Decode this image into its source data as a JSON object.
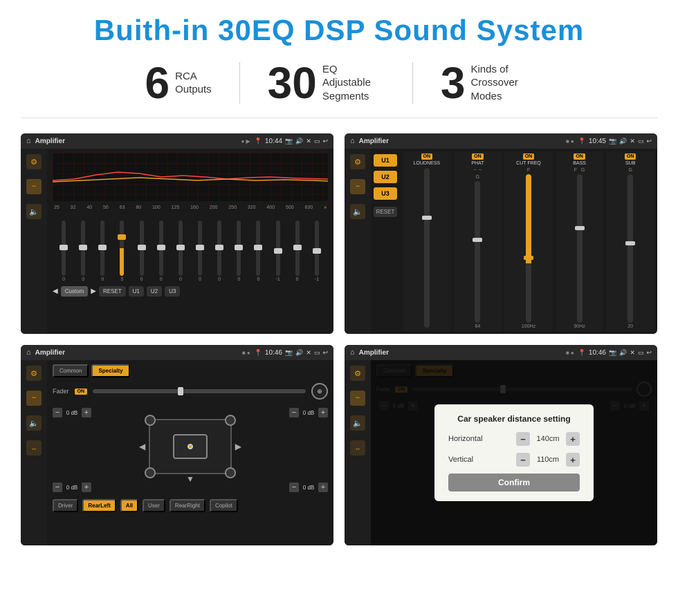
{
  "header": {
    "title": "Buith-in 30EQ DSP Sound System"
  },
  "stats": [
    {
      "number": "6",
      "label": "RCA\nOutputs"
    },
    {
      "number": "30",
      "label": "EQ Adjustable\nSegments"
    },
    {
      "number": "3",
      "label": "Kinds of\nCrossover Modes"
    }
  ],
  "screens": {
    "eq": {
      "topbar": {
        "title": "Amplifier",
        "time": "10:44"
      },
      "frequencies": [
        "25",
        "32",
        "40",
        "50",
        "63",
        "80",
        "100",
        "125",
        "160",
        "200",
        "250",
        "320",
        "400",
        "500",
        "630"
      ],
      "sliders": [
        0,
        0,
        0,
        5,
        0,
        0,
        0,
        0,
        0,
        0,
        0,
        -1,
        0,
        -1
      ],
      "preset": "Custom",
      "buttons": [
        "RESET",
        "U1",
        "U2",
        "U3"
      ]
    },
    "dsp": {
      "topbar": {
        "title": "Amplifier",
        "time": "10:45"
      },
      "channels": [
        {
          "name": "LOUDNESS",
          "on": true
        },
        {
          "name": "PHAT",
          "on": true
        },
        {
          "name": "CUT FREQ",
          "on": true
        },
        {
          "name": "BASS",
          "on": true
        },
        {
          "name": "SUB",
          "on": true
        }
      ],
      "presets": [
        "U1",
        "U2",
        "U3"
      ],
      "reset": "RESET"
    },
    "crossover": {
      "topbar": {
        "title": "Amplifier",
        "time": "10:46"
      },
      "tabs": [
        "Common",
        "Specialty"
      ],
      "activeTab": "Specialty",
      "fader": {
        "label": "Fader",
        "on": true
      },
      "controls": {
        "topLeft": "0 dB",
        "topRight": "0 dB",
        "bottomLeft": "0 dB",
        "bottomRight": "0 dB"
      },
      "buttons": [
        "Driver",
        "RearLeft",
        "All",
        "User",
        "RearRight",
        "Copilot"
      ]
    },
    "dialog": {
      "topbar": {
        "title": "Amplifier",
        "time": "10:46"
      },
      "tabs": [
        "Common",
        "Specialty"
      ],
      "modal": {
        "title": "Car speaker distance setting",
        "horizontal": {
          "label": "Horizontal",
          "value": "140cm"
        },
        "vertical": {
          "label": "Vertical",
          "value": "110cm"
        },
        "confirm": "Confirm"
      },
      "controls": {
        "topLeft": "0 dB",
        "topRight": "0 dB"
      },
      "buttons": [
        "Driver",
        "RearLeft",
        "All",
        "User",
        "RearRight",
        "Copilot"
      ]
    }
  }
}
